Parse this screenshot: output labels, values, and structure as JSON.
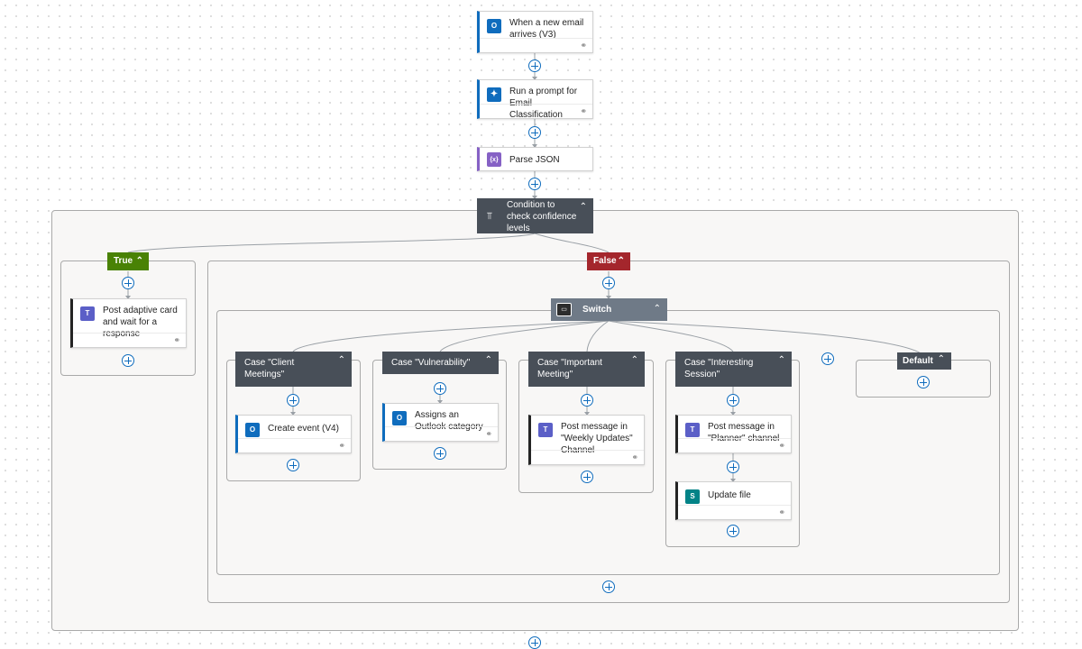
{
  "actions": {
    "trigger_title": "When a new email arrives (V3)",
    "prompt_title": "Run a prompt for Email Classification",
    "parse_title": "Parse JSON",
    "condition_title": "Condition to check confidence levels",
    "true_label": "True",
    "false_label": "False",
    "adaptive_card_title": "Post adaptive card and wait for a response",
    "switch_title": "Switch",
    "cases": [
      {
        "label": "Case \"Client Meetings\"",
        "action": "Create event (V4)"
      },
      {
        "label": "Case \"Vulnerability\"",
        "action": "Assigns an Outlook category"
      },
      {
        "label": "Case \"Important Meeting\"",
        "action": "Post message in \"Weekly Updates\" Channel"
      },
      {
        "label": "Case \"Interesting Session\"",
        "action": "Post message in \"Planner\" channel",
        "action2": "Update file"
      }
    ],
    "default_label": "Default"
  },
  "icons": {
    "outlook": "outlook-icon",
    "ai_prompt": "ai-prompt-icon",
    "parse_json": "json-icon",
    "condition": "condition-icon",
    "teams": "teams-icon",
    "switch": "switch-icon",
    "sharepoint": "sharepoint-icon",
    "link": "link-icon",
    "chevron": "chevron-up-icon",
    "add": "add-step-icon"
  },
  "glyphs": {
    "outlook": "O",
    "ai_prompt": "✦",
    "parse_json": "{x}",
    "condition": "⫪",
    "teams": "T",
    "switch": "▭",
    "sharepoint": "S",
    "link": "⚭",
    "chevron": "⌃"
  },
  "colors": {
    "true_green": "#498205",
    "false_red": "#a4262c",
    "dark_header": "#484f58",
    "switch_header": "#6f7a87",
    "accent_blue": "#0f6cbd"
  }
}
